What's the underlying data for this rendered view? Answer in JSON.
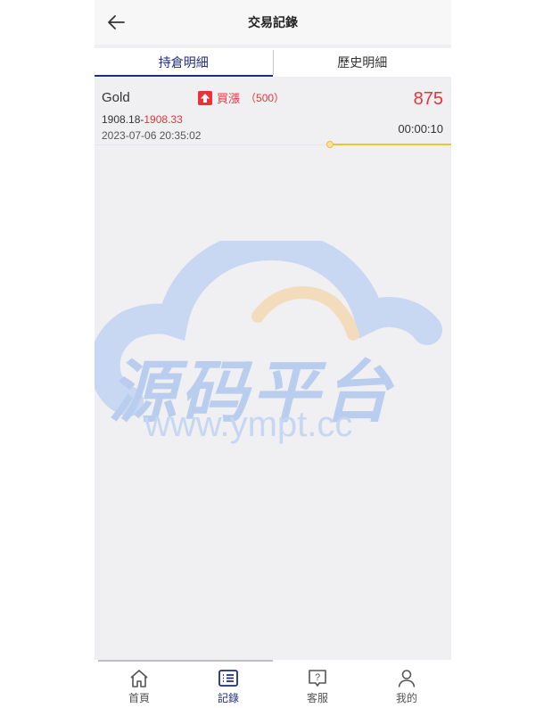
{
  "header": {
    "title": "交易記錄"
  },
  "tabs": [
    {
      "label": "持倉明細",
      "active": true
    },
    {
      "label": "歷史明細",
      "active": false
    }
  ],
  "trade": {
    "symbol": "Gold",
    "direction": "買漲",
    "lots": "（500）",
    "amount": "875",
    "open_price": "1908.18-",
    "current_price": "1908.33",
    "datetime": "2023-07-06 20:35:02",
    "timer": "00:00:10",
    "progress": 0.34
  },
  "watermark": {
    "title": "源码平台",
    "url": "www.ympt.cc"
  },
  "bottom_nav": [
    {
      "label": "首頁",
      "icon": "home-icon",
      "active": false
    },
    {
      "label": "記錄",
      "icon": "list-icon",
      "active": true
    },
    {
      "label": "客服",
      "icon": "help-chat-icon",
      "active": false
    },
    {
      "label": "我的",
      "icon": "user-icon",
      "active": false
    }
  ],
  "colors": {
    "accent": "#1f2d7a",
    "up": "#e8333b",
    "progress": "#f2c12e"
  }
}
